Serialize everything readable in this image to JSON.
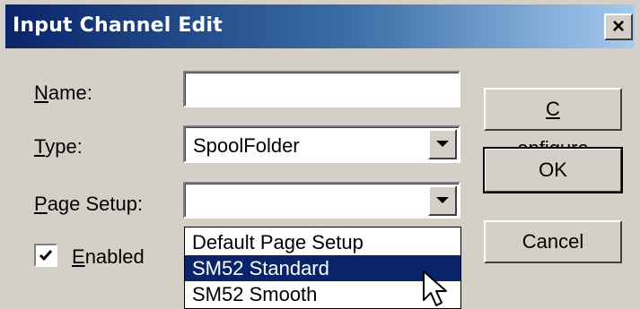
{
  "window": {
    "title": "Input Channel Edit",
    "close_glyph": "×"
  },
  "form": {
    "name": {
      "label_first": "N",
      "label_rest": "ame:",
      "value": ""
    },
    "type": {
      "label_first": "T",
      "label_rest": "ype:",
      "value": "SpoolFolder"
    },
    "page_setup": {
      "label_first": "P",
      "label_rest": "age Setup:",
      "value": ""
    },
    "enabled": {
      "label_first": "E",
      "label_rest": "nabled",
      "checked": true
    }
  },
  "buttons": {
    "configure": {
      "first": "C",
      "rest": "onfigure"
    },
    "ok": {
      "label": "OK"
    },
    "cancel": {
      "label": "Cancel"
    }
  },
  "page_setup_options": [
    "Default Page Setup",
    "SM52 Standard",
    "SM52 Smooth"
  ],
  "selected_option": "SM52 Standard",
  "colors": {
    "dialog_bg": "#d4d0c8",
    "title_gradient_start": "#0a246a",
    "title_gradient_end": "#a6caf0",
    "selection": "#0a246a"
  },
  "icons": {
    "close": "close-icon",
    "dropdown": "chevron-down-icon",
    "check": "checkmark-icon",
    "cursor": "mouse-pointer-icon"
  }
}
